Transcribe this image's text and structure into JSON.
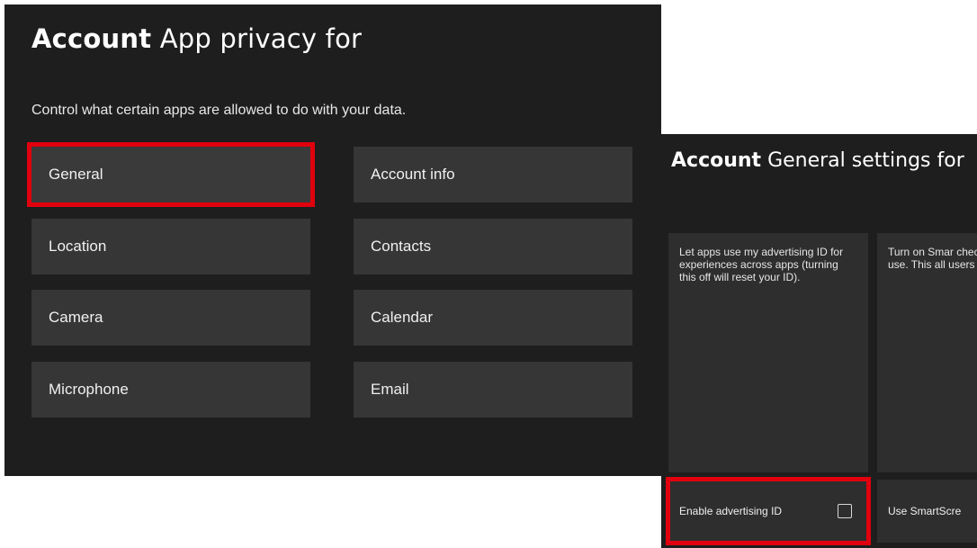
{
  "privacy": {
    "title_bold": "Account",
    "title_rest": "App privacy for",
    "description": "Control what certain apps are allowed to do with your data.",
    "tiles_left": [
      "General",
      "Location",
      "Camera",
      "Microphone"
    ],
    "tiles_right": [
      "Account info",
      "Contacts",
      "Calendar",
      "Email"
    ],
    "selected_tile": "General"
  },
  "general": {
    "title_bold": "Account",
    "title_rest": "General settings for",
    "advertising_text": "Let apps use my advertising ID for experiences across apps (turning this off will reset your ID).",
    "smartscreen_text": "Turn on Smar check web co apps use. This all users on th",
    "advertising_toggle_label": "Enable advertising ID",
    "smartscreen_toggle_label": "Use SmartScre",
    "advertising_enabled": false
  },
  "colors": {
    "highlight": "#e0000e",
    "panel_background": "#1e1e1e",
    "tile_background": "#363636"
  }
}
